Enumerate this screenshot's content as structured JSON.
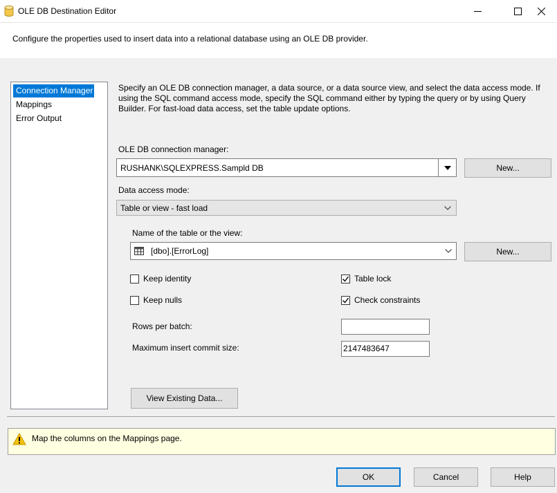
{
  "window": {
    "title": "OLE DB Destination Editor",
    "description": "Configure the properties used to insert data into a relational database using an OLE DB provider."
  },
  "nav": {
    "items": [
      {
        "label": "Connection Manager",
        "selected": true
      },
      {
        "label": "Mappings",
        "selected": false
      },
      {
        "label": "Error Output",
        "selected": false
      }
    ]
  },
  "content": {
    "description": "Specify an OLE DB connection manager, a data source, or a data source view, and select the data access mode. If using the SQL command access mode, specify the SQL command either by typing the query or by using Query Builder. For fast-load data access, set the table update options.",
    "connection_manager_label": "OLE DB connection manager:",
    "connection_manager_value": "RUSHANK\\SQLEXPRESS.Sampld DB",
    "new_label": "New...",
    "data_access_mode_label": "Data access mode:",
    "data_access_mode_value": "Table or view - fast load",
    "table_name_label": "Name of the table or the view:",
    "table_name_value": "[dbo].[ErrorLog]",
    "keep_identity_label": "Keep identity",
    "keep_nulls_label": "Keep nulls",
    "table_lock_label": "Table lock",
    "check_constraints_label": "Check constraints",
    "rows_per_batch_label": "Rows per batch:",
    "rows_per_batch_value": "",
    "max_commit_label": "Maximum insert commit size:",
    "max_commit_value": "2147483647",
    "view_existing_label": "View Existing Data..."
  },
  "message": {
    "text": "Map the columns on the Mappings page."
  },
  "footer": {
    "ok_label": "OK",
    "cancel_label": "Cancel",
    "help_label": "Help"
  },
  "colors": {
    "accent": "#0078d7",
    "warning": "#f4c20d",
    "message_bg": "#ffffe1"
  }
}
